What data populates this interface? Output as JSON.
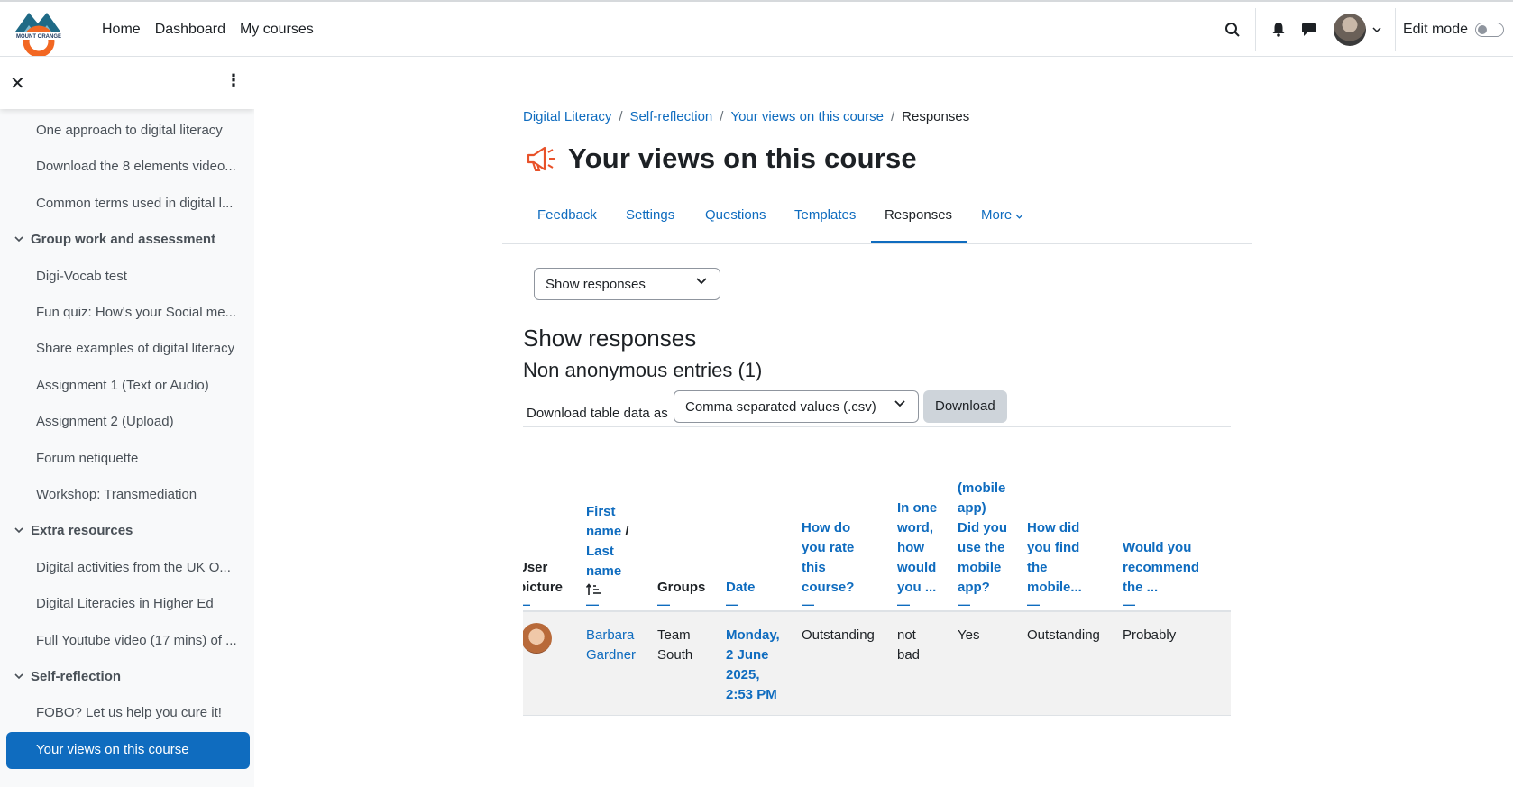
{
  "nav": {
    "links": [
      "Home",
      "Dashboard",
      "My courses"
    ],
    "edit_mode_label": "Edit mode",
    "logo_text": "MOUNT ORANGE"
  },
  "drawer": {
    "items": [
      {
        "type": "item",
        "label": "One approach to digital literacy"
      },
      {
        "type": "item",
        "label": "Download the 8 elements video..."
      },
      {
        "type": "item",
        "label": "Common terms used in digital l..."
      },
      {
        "type": "section",
        "label": "Group work and assessment"
      },
      {
        "type": "item",
        "label": "Digi-Vocab test"
      },
      {
        "type": "item",
        "label": "Fun quiz: How's your Social me..."
      },
      {
        "type": "item",
        "label": "Share examples of digital literacy"
      },
      {
        "type": "item",
        "label": "Assignment 1 (Text or Audio)"
      },
      {
        "type": "item",
        "label": "Assignment 2 (Upload)"
      },
      {
        "type": "item",
        "label": "Forum netiquette"
      },
      {
        "type": "item",
        "label": "Workshop: Transmediation"
      },
      {
        "type": "section",
        "label": "Extra resources"
      },
      {
        "type": "item",
        "label": "Digital activities from the UK O..."
      },
      {
        "type": "item",
        "label": "Digital Literacies in Higher Ed"
      },
      {
        "type": "item",
        "label": "Full Youtube video (17 mins) of ..."
      },
      {
        "type": "section",
        "label": "Self-reflection"
      },
      {
        "type": "item",
        "label": "FOBO? Let us help you cure it!"
      },
      {
        "type": "active",
        "label": "Your views on this course"
      }
    ]
  },
  "breadcrumb": [
    "Digital Literacy",
    "Self-reflection",
    "Your views on this course",
    "Responses"
  ],
  "page_title": "Your views on this course",
  "tabs": [
    "Feedback",
    "Settings",
    "Questions",
    "Templates",
    "Responses",
    "More"
  ],
  "active_tab": "Responses",
  "show_select": "Show responses",
  "heading": "Show responses",
  "subheading": "Non anonymous entries (1)",
  "download": {
    "label": "Download table data as",
    "format": "Comma separated values (.csv)",
    "button": "Download"
  },
  "table": {
    "headers": {
      "user_picture": "User picture",
      "first_name": "First name",
      "last_name": "Last name",
      "groups": "Groups",
      "date": "Date",
      "q1": "How do you rate this course?",
      "q2": "In one word, how would you ...",
      "q3": "(mobile app) Did you use the mobile app?",
      "q4": "How did you find the mobile...",
      "q5": "Would you recommend the ..."
    },
    "row": {
      "first_name": "Barbara",
      "last_name": "Gardner",
      "groups": "Team South",
      "date": "Monday, 2 June 2025, 2:53 PM",
      "q1": "Outstanding",
      "q2": "not bad",
      "q3": "Yes",
      "q4": "Outstanding",
      "q5": "Probably"
    }
  }
}
